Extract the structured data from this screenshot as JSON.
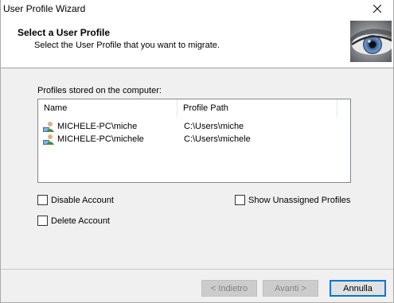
{
  "window": {
    "title": "User Profile Wizard"
  },
  "header": {
    "title": "Select a User Profile",
    "subtitle": "Select the User Profile that you want to migrate."
  },
  "profiles": {
    "caption": "Profiles stored on the computer:",
    "columns": [
      "Name",
      "Profile Path"
    ],
    "rows": [
      {
        "name": "MICHELE-PC\\miche",
        "path": "C:\\Users\\miche",
        "icon": "user-profile-icon"
      },
      {
        "name": "MICHELE-PC\\michele",
        "path": "C:\\Users\\michele",
        "icon": "user-profile-icon"
      }
    ]
  },
  "options": {
    "disable_account": {
      "label": "Disable Account",
      "checked": false
    },
    "delete_account": {
      "label": "Delete Account",
      "checked": false
    },
    "show_unassigned": {
      "label": "Show Unassigned Profiles",
      "checked": false
    }
  },
  "buttons": {
    "back": "< Indietro",
    "next": "Avanti >",
    "cancel": "Annulla"
  },
  "colors": {
    "accent": "#0078d7",
    "disabled_text": "#838383"
  }
}
